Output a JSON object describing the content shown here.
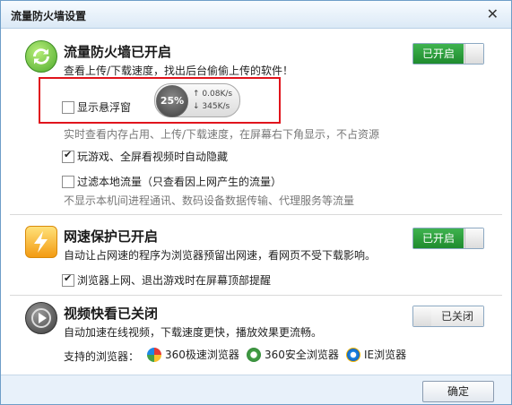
{
  "window": {
    "title": "流量防火墙设置",
    "close_glyph": "✕"
  },
  "firewall": {
    "title": "流量防火墙已开启",
    "desc": "查看上传/下载速度，找出后台偷偷上传的软件！",
    "toggle_label": "已开启",
    "show_float_label": "显示悬浮窗",
    "float_percent": "25%",
    "float_up": "↑ 0.08K/s",
    "float_down": "↓ 345K/s",
    "realtime_note": "实时查看内存占用、上传/下载速度，在屏幕右下角显示，不占资源",
    "autohide_label": "玩游戏、全屏看视频时自动隐藏",
    "filter_label": "过滤本地流量（只查看因上网产生的流量）",
    "filter_note": "不显示本机间进程通讯、数码设备数据传输、代理服务等流量"
  },
  "speed_protect": {
    "title": "网速保护已开启",
    "desc": "自动让占网速的程序为浏览器预留出网速，看网页不受下载影响。",
    "toggle_label": "已开启",
    "notify_label": "浏览器上网、退出游戏时在屏幕顶部提醒"
  },
  "video": {
    "title": "视频快看已关闭",
    "desc": "自动加速在线视频，下载速度更快，播放效果更流畅。",
    "toggle_label": "已关闭",
    "browsers_label": "支持的浏览器：",
    "browsers": [
      "360极速浏览器",
      "360安全浏览器",
      "IE浏览器"
    ]
  },
  "footer": {
    "ok_label": "确定"
  },
  "colors": {
    "accent_green": "#1f8b2e",
    "highlight_red": "#e0141c",
    "title_bar": "#dbe9f6"
  }
}
